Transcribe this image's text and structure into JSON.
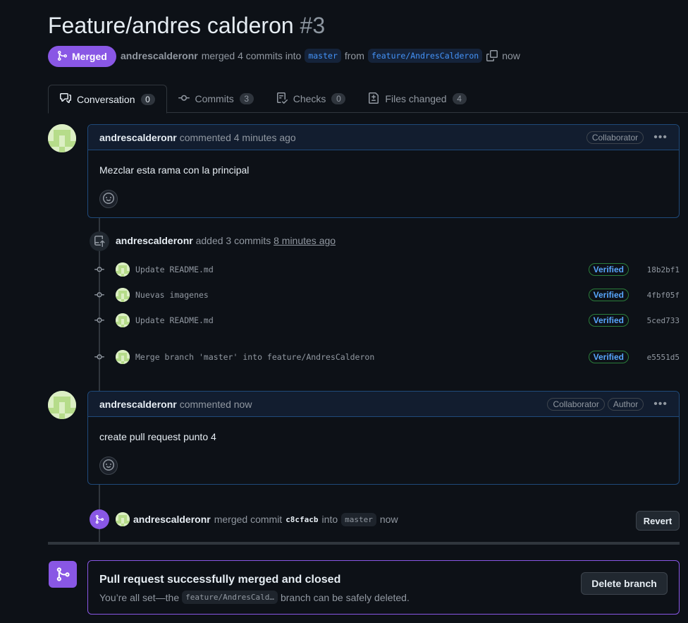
{
  "pr": {
    "title": "Feature/andres calderon",
    "number": "#3",
    "state": "Merged",
    "author": "andrescalderonr",
    "merge_text": "merged 4 commits into",
    "base_branch": "master",
    "from_text": "from",
    "head_branch": "feature/AndresCalderon",
    "time": "now"
  },
  "tabs": [
    {
      "label": "Conversation",
      "count": "0",
      "icon": "comment-discussion-icon"
    },
    {
      "label": "Commits",
      "count": "3",
      "icon": "git-commit-icon"
    },
    {
      "label": "Checks",
      "count": "0",
      "icon": "checklist-icon"
    },
    {
      "label": "Files changed",
      "count": "4",
      "icon": "file-diff-icon"
    }
  ],
  "comment1": {
    "author": "andrescalderonr",
    "action": "commented 4 minutes ago",
    "labels": [
      "Collaborator"
    ],
    "body": "Mezclar esta rama con la principal"
  },
  "commits_event": {
    "author": "andrescalderonr",
    "action": "added 3 commits",
    "time": "8 minutes ago"
  },
  "commits": [
    {
      "message": "Update README.md",
      "verified": "Verified",
      "sha": "18b2bf1"
    },
    {
      "message": "Nuevas imagenes",
      "verified": "Verified",
      "sha": "4fbf05f"
    },
    {
      "message": "Update README.md",
      "verified": "Verified",
      "sha": "5ced733"
    },
    {
      "message": "Merge branch 'master' into feature/AndresCalderon",
      "verified": "Verified",
      "sha": "e5551d5"
    }
  ],
  "comment2": {
    "author": "andrescalderonr",
    "action": "commented now",
    "labels": [
      "Collaborator",
      "Author"
    ],
    "body": "create pull request punto 4"
  },
  "merged_event": {
    "author": "andrescalderonr",
    "action": "merged commit",
    "commit": "c8cfacb",
    "into": "into",
    "branch": "master",
    "time": "now",
    "revert_label": "Revert"
  },
  "merge_box": {
    "title": "Pull request successfully merged and closed",
    "sub_before": "You’re all set—the",
    "branch": "feature/AndresCald…",
    "sub_after": "branch can be safely deleted.",
    "delete_label": "Delete branch"
  },
  "colors": {
    "merged": "#8957e5",
    "link": "#4493f8",
    "verified_border": "#2a7d3a"
  }
}
